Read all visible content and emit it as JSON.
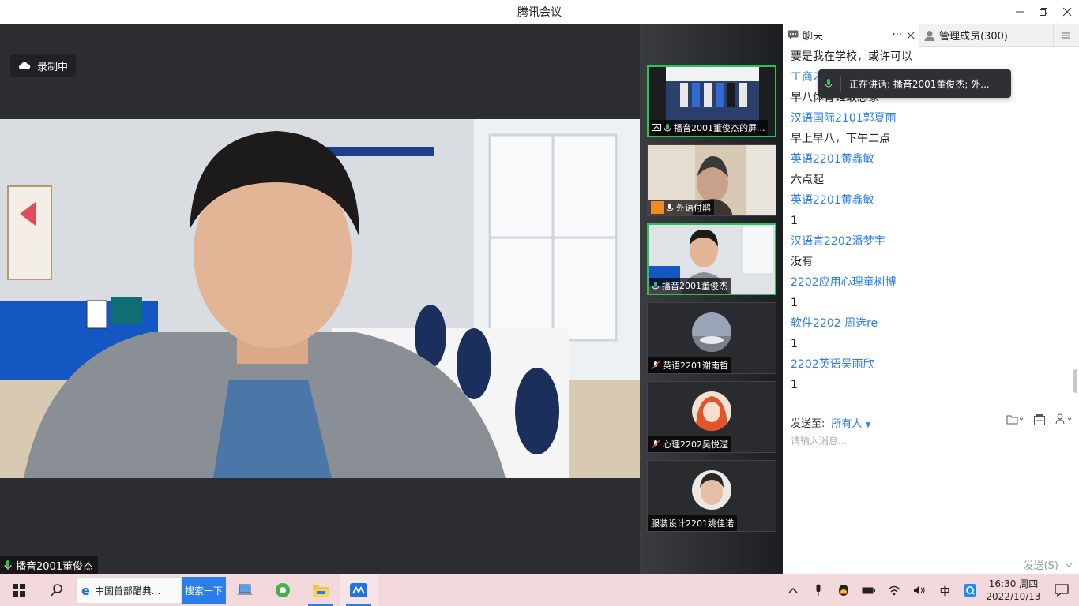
{
  "window": {
    "title": "腾讯会议"
  },
  "main": {
    "recording_label": "录制中",
    "speaker_name": "播音2001董俊杰"
  },
  "thumbnails": [
    {
      "label": "播音2001董俊杰的屏..."
    },
    {
      "label": "外语付鹃"
    },
    {
      "label": "播音2001董俊杰"
    },
    {
      "label": "英语2201谢南哲"
    },
    {
      "label": "心理2202吴悦滢"
    },
    {
      "label": "服装设计2201姚佳诺"
    }
  ],
  "chat": {
    "tab_chat": "聊天",
    "tab_more": "···",
    "tab_members": "管理成员(300)",
    "messages": [
      {
        "kind": "text",
        "content": "要是我在学校，或许可以"
      },
      {
        "kind": "sender",
        "content": "工商2"
      },
      {
        "kind": "text",
        "content": "早八体育谁敢想象"
      },
      {
        "kind": "sender",
        "content": "汉语国际2101郭夏雨"
      },
      {
        "kind": "text",
        "content": "早上早八，下午二点"
      },
      {
        "kind": "sender",
        "content": "英语2201黄鑫敏"
      },
      {
        "kind": "text",
        "content": "六点起"
      },
      {
        "kind": "sender",
        "content": "英语2201黄鑫敏"
      },
      {
        "kind": "text",
        "content": "1"
      },
      {
        "kind": "sender",
        "content": "汉语言2202潘梦宇"
      },
      {
        "kind": "text",
        "content": "没有"
      },
      {
        "kind": "sender",
        "content": "2202应用心理童树博"
      },
      {
        "kind": "text",
        "content": "1"
      },
      {
        "kind": "sender",
        "content": "软件2202 周选re"
      },
      {
        "kind": "text",
        "content": "1"
      },
      {
        "kind": "sender",
        "content": "2202英语吴雨欣"
      },
      {
        "kind": "text",
        "content": "1"
      }
    ],
    "send_to_label": "发送至:",
    "send_to_value": "所有人",
    "input_placeholder": "请输入消息...",
    "send_label": "发送(S)",
    "speaking_toast": "正在讲话: 播音2001董俊杰; 外..."
  },
  "taskbar": {
    "browser_tab": "中国首部醋典...",
    "search_button": "搜索一下",
    "ime": "中",
    "time": "16:30 周四",
    "date": "2022/10/13"
  },
  "colors": {
    "accent": "#2b7de9",
    "active_border": "#2fbf5b",
    "taskbar_bg": "#f3d8dc"
  }
}
